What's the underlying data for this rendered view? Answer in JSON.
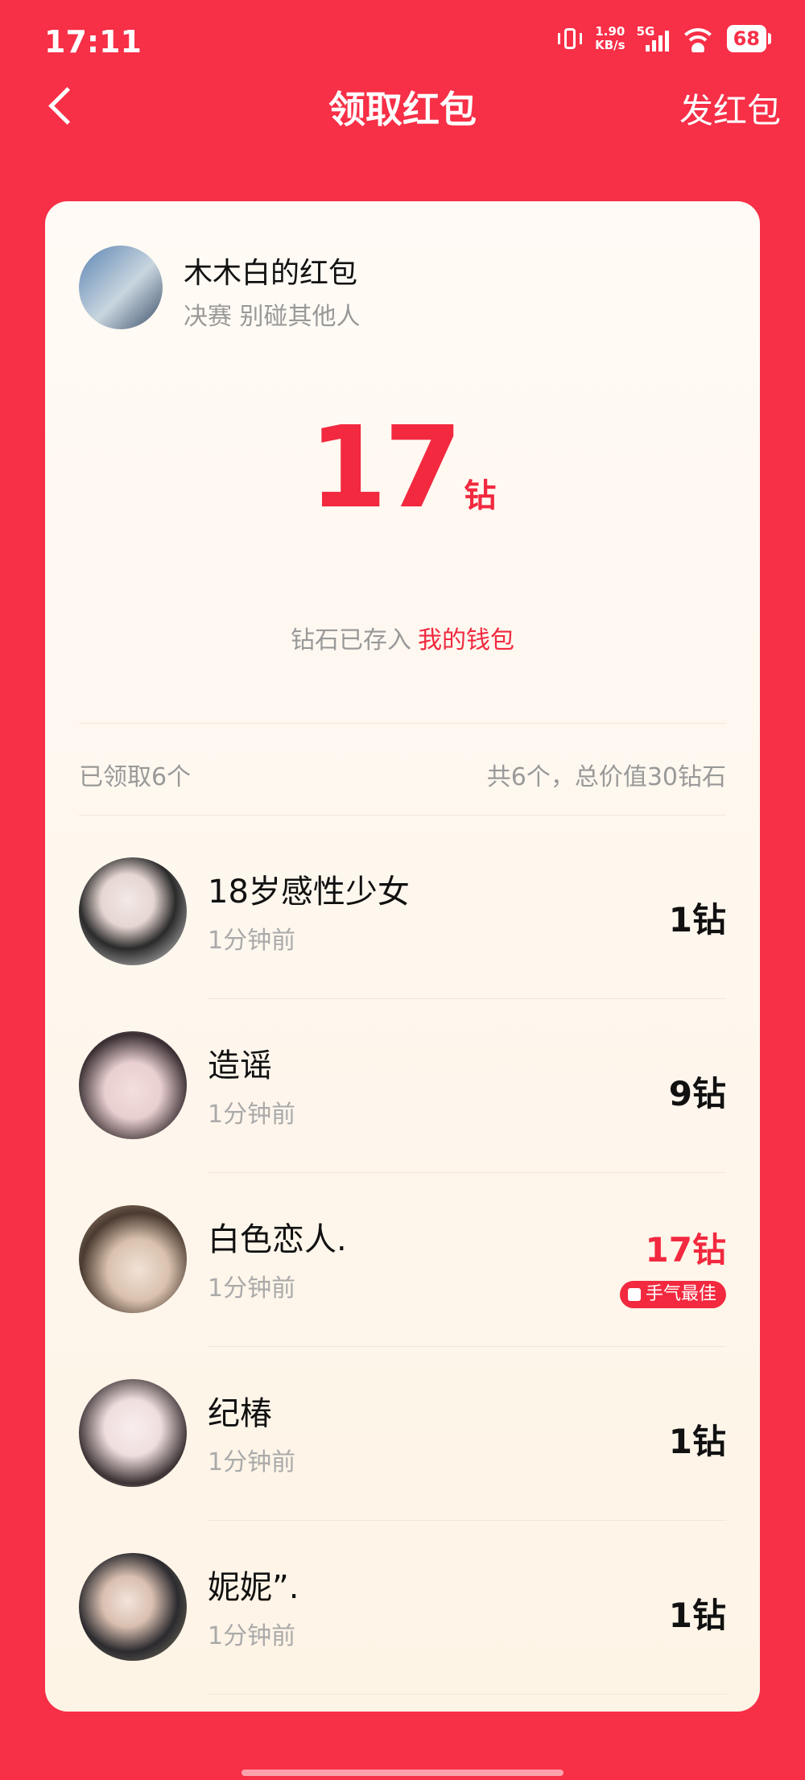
{
  "status_bar": {
    "time": "17:11",
    "speed_value": "1.90",
    "speed_unit": "KB/s",
    "network": "5G",
    "battery": "68"
  },
  "header": {
    "title": "领取红包",
    "send_label": "发红包"
  },
  "card": {
    "sender_name": "木木白的红包",
    "sender_message": "决赛 别碰其他人",
    "amount": "17",
    "amount_unit": "钻",
    "stored_text": "钻石已存入",
    "wallet_link": "我的钱包",
    "summary_left": "已领取6个",
    "summary_right": "共6个，总价值30钻石"
  },
  "receivers": [
    {
      "name": "18岁感性少女",
      "time": "1分钟前",
      "value": "1钻"
    },
    {
      "name": "造谣",
      "time": "1分钟前",
      "value": "9钻"
    },
    {
      "name": "白色恋人.",
      "time": "1分钟前",
      "value": "17钻",
      "badge": "手气最佳"
    },
    {
      "name": "纪椿",
      "time": "1分钟前",
      "value": "1钻"
    },
    {
      "name": "妮妮”.",
      "time": "1分钟前",
      "value": "1钻"
    }
  ],
  "colors": {
    "background": "#f72f47",
    "accent": "#f2293f",
    "card": "#fef6ec"
  }
}
